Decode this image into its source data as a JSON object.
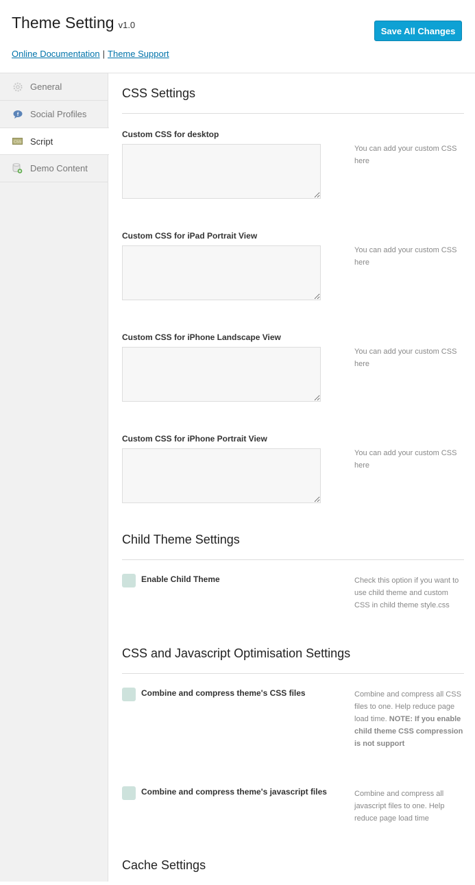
{
  "header": {
    "title": "Theme Setting",
    "version": "v1.0",
    "links": [
      {
        "label": "Online Documentation"
      },
      {
        "label": "Theme Support"
      }
    ],
    "separator": "|",
    "save_label": "Save All Changes",
    "accent_color": "#0ea1d4"
  },
  "sidebar": {
    "items": [
      {
        "label": "General",
        "icon": "gear-icon",
        "active": false
      },
      {
        "label": "Social Profiles",
        "icon": "facebook-bubble-icon",
        "active": false
      },
      {
        "label": "Script",
        "icon": "css-icon",
        "active": true
      },
      {
        "label": "Demo Content",
        "icon": "database-add-icon",
        "active": false
      }
    ]
  },
  "sections": {
    "css": {
      "title": "CSS Settings",
      "fields": [
        {
          "label": "Custom CSS for desktop",
          "value": "",
          "desc": "You can add your custom CSS here"
        },
        {
          "label": "Custom CSS for iPad Portrait View",
          "value": "",
          "desc": "You can add your custom CSS here"
        },
        {
          "label": "Custom CSS for iPhone Landscape View",
          "value": "",
          "desc": "You can add your custom CSS here"
        },
        {
          "label": "Custom CSS for iPhone Portrait View",
          "value": "",
          "desc": "You can add your custom CSS here"
        }
      ]
    },
    "child": {
      "title": "Child Theme Settings",
      "option": {
        "label": "Enable Child Theme",
        "checked": false,
        "desc": "Check this option if you want to use child theme and custom CSS in child theme style.css"
      }
    },
    "optim": {
      "title": "CSS and Javascript Optimisation Settings",
      "options": [
        {
          "label": "Combine and compress theme's CSS files",
          "checked": false,
          "desc": "Combine and compress all CSS files to one. Help reduce page load time.",
          "note": "NOTE: If you enable child theme CSS compression is not support"
        },
        {
          "label": "Combine and compress theme's javascript files",
          "checked": false,
          "desc": "Combine and compress all javascript files to one. Help reduce page load time"
        }
      ]
    },
    "cache": {
      "title": "Cache Settings"
    }
  }
}
